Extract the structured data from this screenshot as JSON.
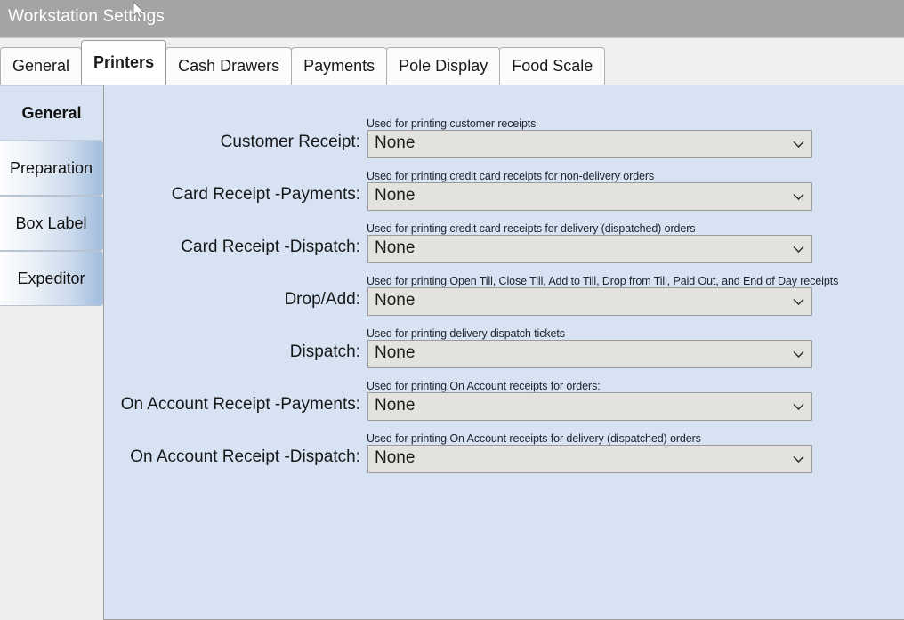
{
  "window": {
    "title": "Workstation Settings",
    "titlebar_color": "#a4a4a4",
    "cursor_icon": "mouse-pointer-icon"
  },
  "tabs": [
    {
      "label": "General",
      "selected": false
    },
    {
      "label": "Printers",
      "selected": true
    },
    {
      "label": "Cash Drawers",
      "selected": false
    },
    {
      "label": "Payments",
      "selected": false
    },
    {
      "label": "Pole Display",
      "selected": false
    },
    {
      "label": "Food Scale",
      "selected": false
    }
  ],
  "sidebar": {
    "items": [
      {
        "label": "General",
        "active": true
      },
      {
        "label": "Preparation",
        "active": false
      },
      {
        "label": "Box Label",
        "active": false
      },
      {
        "label": "Expeditor",
        "active": false
      }
    ]
  },
  "content": {
    "panel_color": "#d7e3f2",
    "fields": [
      {
        "hint": "Used for printing customer receipts",
        "label": "Customer Receipt:",
        "value": "None",
        "dropdown_icon": "chevron-down-icon"
      },
      {
        "hint": "Used for printing credit card receipts for non-delivery orders",
        "label": "Card Receipt -Payments:",
        "value": "None",
        "dropdown_icon": "chevron-down-icon"
      },
      {
        "hint": "Used for printing credit card receipts for delivery (dispatched) orders",
        "label": "Card Receipt -Dispatch:",
        "value": "None",
        "dropdown_icon": "chevron-down-icon"
      },
      {
        "hint": "Used for printing Open Till, Close Till, Add to Till, Drop from Till, Paid Out, and End of Day receipts",
        "label": "Drop/Add:",
        "value": "None",
        "dropdown_icon": "chevron-down-icon"
      },
      {
        "hint": "Used for printing delivery dispatch tickets",
        "label": "Dispatch:",
        "value": "None",
        "dropdown_icon": "chevron-down-icon"
      },
      {
        "hint": "Used for printing On Account receipts for orders:",
        "label": "On Account Receipt -Payments:",
        "value": "None",
        "dropdown_icon": "chevron-down-icon"
      },
      {
        "hint": "Used for printing On Account receipts for delivery (dispatched) orders",
        "label": "On Account Receipt -Dispatch:",
        "value": "None",
        "dropdown_icon": "chevron-down-icon"
      }
    ]
  }
}
